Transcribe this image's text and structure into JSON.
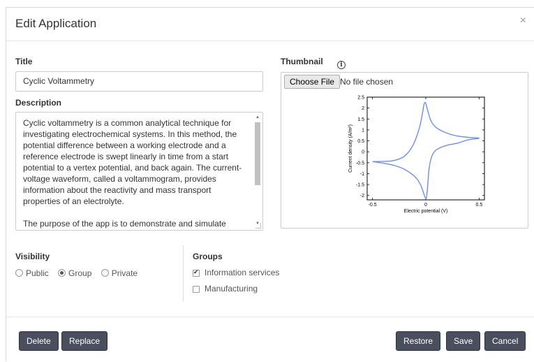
{
  "dialog": {
    "title": "Edit Application",
    "close_glyph": "×"
  },
  "form": {
    "title_label": "Title",
    "title_value": "Cyclic Voltammetry",
    "description_label": "Description",
    "description_value": "Cyclic voltammetry is a common analytical technique for investigating electrochemical systems. In this method, the potential difference between a working electrode and a reference electrode is swept linearly in time from a start potential to a vertex potential, and back again. The current-voltage waveform, called a voltammogram, provides information about the reactivity and mass transport properties of an electrolyte.\n\nThe purpose of the app is to demonstrate and simulate",
    "thumbnail_label": "Thumbnail",
    "info_glyph": "i",
    "file_button_label": "Choose File",
    "file_status": "No file chosen"
  },
  "visibility": {
    "label": "Visibility",
    "options": [
      {
        "label": "Public",
        "selected": false
      },
      {
        "label": "Group",
        "selected": true
      },
      {
        "label": "Private",
        "selected": false
      }
    ]
  },
  "groups": {
    "label": "Groups",
    "items": [
      {
        "label": "Information services",
        "checked": true
      },
      {
        "label": "Manufacturing",
        "checked": false
      }
    ]
  },
  "footer": {
    "delete_label": "Delete",
    "replace_label": "Replace",
    "restore_label": "Restore",
    "save_label": "Save",
    "cancel_label": "Cancel"
  },
  "colors": {
    "curve": "#6b8ff0",
    "button_bg": "#4a4f5e"
  },
  "chart_data": {
    "type": "line",
    "xlabel": "Electric potential (V)",
    "ylabel": "Current density (A/m²)",
    "xlim": [
      -0.55,
      0.55
    ],
    "ylim": [
      -2.2,
      2.5
    ],
    "xticks": [
      -0.5,
      0,
      0.5
    ],
    "yticks": [
      -2,
      -1.5,
      -1,
      -0.5,
      0,
      0.5,
      1,
      1.5,
      2,
      2.5
    ],
    "xtick_labels": [
      "-0.5",
      "0",
      "0.5"
    ],
    "ytick_labels": [
      "-2",
      "-1.5",
      "-1",
      "-0.5",
      "0",
      "0.5",
      "1",
      "1.5",
      "2",
      "2.5"
    ],
    "series": [
      {
        "x": [
          -0.5,
          -0.4,
          -0.3,
          -0.2,
          -0.12,
          -0.06,
          -0.03,
          -0.02,
          -0.01,
          0.0,
          0.02,
          0.05,
          0.1,
          0.2,
          0.3,
          0.4,
          0.5,
          0.4,
          0.3,
          0.2,
          0.12,
          0.08,
          0.05,
          0.03,
          0.02,
          0.01,
          0.0,
          -0.02,
          -0.05,
          -0.1,
          -0.2,
          -0.3,
          -0.4,
          -0.5
        ],
        "y": [
          -0.45,
          -0.44,
          -0.4,
          -0.2,
          0.3,
          1.1,
          1.8,
          2.1,
          2.25,
          2.2,
          1.85,
          1.4,
          1.1,
          0.85,
          0.72,
          0.66,
          0.62,
          0.55,
          0.4,
          0.3,
          0.15,
          0.0,
          -0.3,
          -0.8,
          -1.4,
          -1.95,
          -2.15,
          -1.9,
          -1.5,
          -1.15,
          -0.8,
          -0.62,
          -0.52,
          -0.45
        ]
      }
    ]
  }
}
